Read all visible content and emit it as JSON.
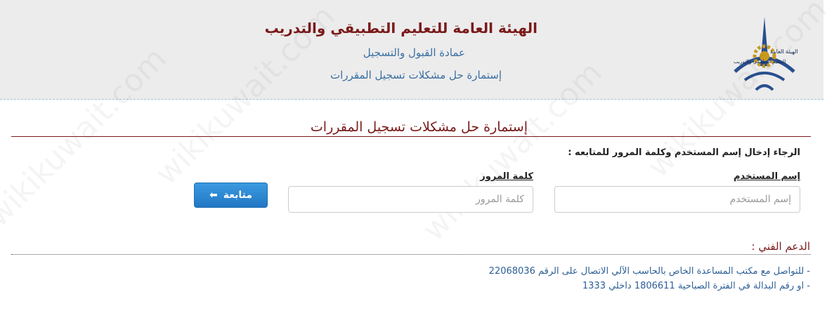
{
  "header": {
    "title": "الهيئة العامة للتعليم التطبيقي والتدريب",
    "subtitle1": "عمادة القبول والتسجيل",
    "subtitle2": "إستمارة حل مشكلات تسجيل المقررات",
    "logo_icon": "paaet-logo-icon",
    "logo_text_line1": "الهيئة العامة",
    "logo_text_line2": "للتعليم التطبيقي والتدريب"
  },
  "form": {
    "heading": "إستمارة حل مشكلات تسجيل المقررات",
    "instruction": "الرجاء إدخال إسم المستخدم وكلمة المرور للمتابعه :",
    "username_label": "إسم المستخدم",
    "username_placeholder": "إسم المستخدم",
    "username_value": "",
    "password_label": "كلمة المرور",
    "password_placeholder": "كلمة المرور",
    "password_value": "",
    "continue_label": "متابعة",
    "continue_icon": "arrow-left-icon"
  },
  "support": {
    "title": "الدعم الفني :",
    "line1": "- للتواصل مع مكتب المساعدة الخاص بالحاسب الآلي الاتصال على الرقم 22068036",
    "line2": "- او رقم البدالة في الفترة الصباحية 1806611 داخلي 1333"
  },
  "watermark": "wikikuwait.com",
  "colors": {
    "header_bg": "#ececec",
    "title": "#7b1a1a",
    "link_blue": "#3a6fa3",
    "button": "#2a85d0"
  }
}
